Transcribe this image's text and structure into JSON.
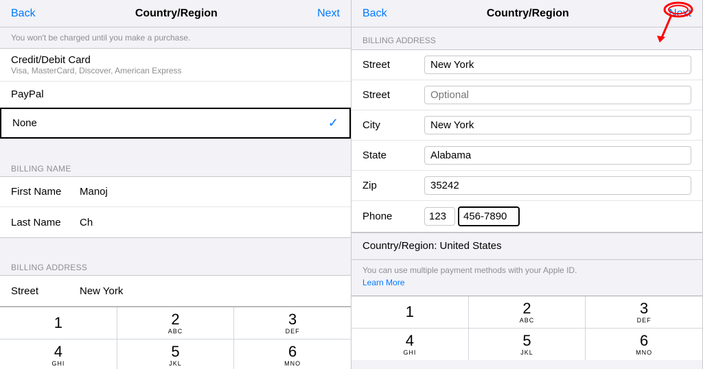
{
  "left_panel": {
    "nav": {
      "back_label": "Back",
      "title": "Country/Region",
      "next_label": "Next"
    },
    "info_text": "You won't be charged until you make a purchase.",
    "credit_card": {
      "label": "Credit/Debit Card",
      "sub": "Visa, MasterCard, Discover, American Express"
    },
    "paypal_label": "PayPal",
    "selected_payment": "None",
    "billing_name_header": "BILLING NAME",
    "first_name_label": "First Name",
    "first_name_value": "Manoj",
    "last_name_label": "Last Name",
    "last_name_value": "Ch",
    "billing_address_header": "BILLING ADDRESS",
    "street_label": "Street",
    "street_value": "New York",
    "keyboard": {
      "keys": [
        {
          "main": "1",
          "sub": ""
        },
        {
          "main": "2",
          "sub": "ABC"
        },
        {
          "main": "3",
          "sub": "DEF"
        },
        {
          "main": "4",
          "sub": "GHI"
        },
        {
          "main": "5",
          "sub": "JKL"
        },
        {
          "main": "6",
          "sub": "MNO"
        }
      ]
    }
  },
  "right_panel": {
    "nav": {
      "back_label": "Back",
      "title": "Country/Region",
      "next_label": "Next"
    },
    "billing_address_header": "BILLING ADDRESS",
    "street1_label": "Street",
    "street1_value": "New York",
    "street2_label": "Street",
    "street2_placeholder": "Optional",
    "city_label": "City",
    "city_value": "New York",
    "state_label": "State",
    "state_value": "Alabama",
    "zip_label": "Zip",
    "zip_value": "35242",
    "phone_label": "Phone",
    "phone_area": "123",
    "phone_number": "456-7890",
    "country_region_text": "Country/Region: United States",
    "learn_more_text": "You can use multiple payment methods with your Apple ID.",
    "learn_more_link": "Learn More",
    "keyboard": {
      "keys": [
        {
          "main": "1",
          "sub": ""
        },
        {
          "main": "2",
          "sub": "ABC"
        },
        {
          "main": "3",
          "sub": "DEF"
        },
        {
          "main": "4",
          "sub": "GHI"
        },
        {
          "main": "5",
          "sub": "JKL"
        },
        {
          "main": "6",
          "sub": "MNO"
        }
      ]
    }
  }
}
